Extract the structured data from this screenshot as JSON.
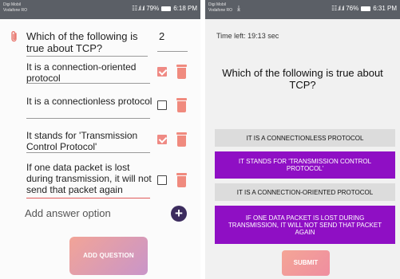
{
  "left_screen": {
    "status_bar": {
      "carrier_line1": "Digi Mobil",
      "carrier_line2": "Vodafone RO",
      "signal_text": "☷ .ıl .ıl",
      "battery_percent": "79%",
      "time": "6:18 PM"
    },
    "question_text": "Which of the following is true about TCP?",
    "points": "2",
    "options": [
      {
        "text": "It is a connection-oriented protocol",
        "checked": true
      },
      {
        "text": "It is a connectionless protocol",
        "checked": false
      },
      {
        "text": "It stands for 'Transmission Control Protocol'",
        "checked": true
      },
      {
        "text": "If one data packet is lost during transmission, it will not send that packet again",
        "checked": false
      }
    ],
    "add_option_label": "Add answer option",
    "add_option_icon": "+",
    "add_question_label": "ADD QUESTION",
    "attach_icon": "paperclip-icon"
  },
  "right_screen": {
    "status_bar": {
      "carrier_line1": "Digi Mobil",
      "carrier_line2": "Vodafone RO",
      "download_icon": "⤓",
      "signal_text": "☷ .ıl .ıl",
      "battery_percent": "76%",
      "time": "6:31 PM"
    },
    "time_left": "Time left: 19:13 sec",
    "question_text": "Which of the following is true about TCP?",
    "answers": [
      {
        "text": "IT IS A CONNECTIONLESS PROTOCOL",
        "style": "grey"
      },
      {
        "text": "IT STANDS FOR 'TRANSMISSION CONTROL PROTOCOL'",
        "style": "purple"
      },
      {
        "text": "IT IS A CONNECTION-ORIENTED PROTOCOL",
        "style": "grey"
      },
      {
        "text": "IF ONE DATA PACKET IS LOST DURING TRANSMISSION, IT WILL NOT SEND THAT PACKET AGAIN",
        "style": "purple"
      }
    ],
    "submit_label": "SUBMIT"
  },
  "colors": {
    "accent_purple": "#8f0fc4",
    "answer_grey": "#dcdcdc",
    "checkbox_coral": "#ef8a84",
    "add_circle": "#3c2c5e"
  }
}
